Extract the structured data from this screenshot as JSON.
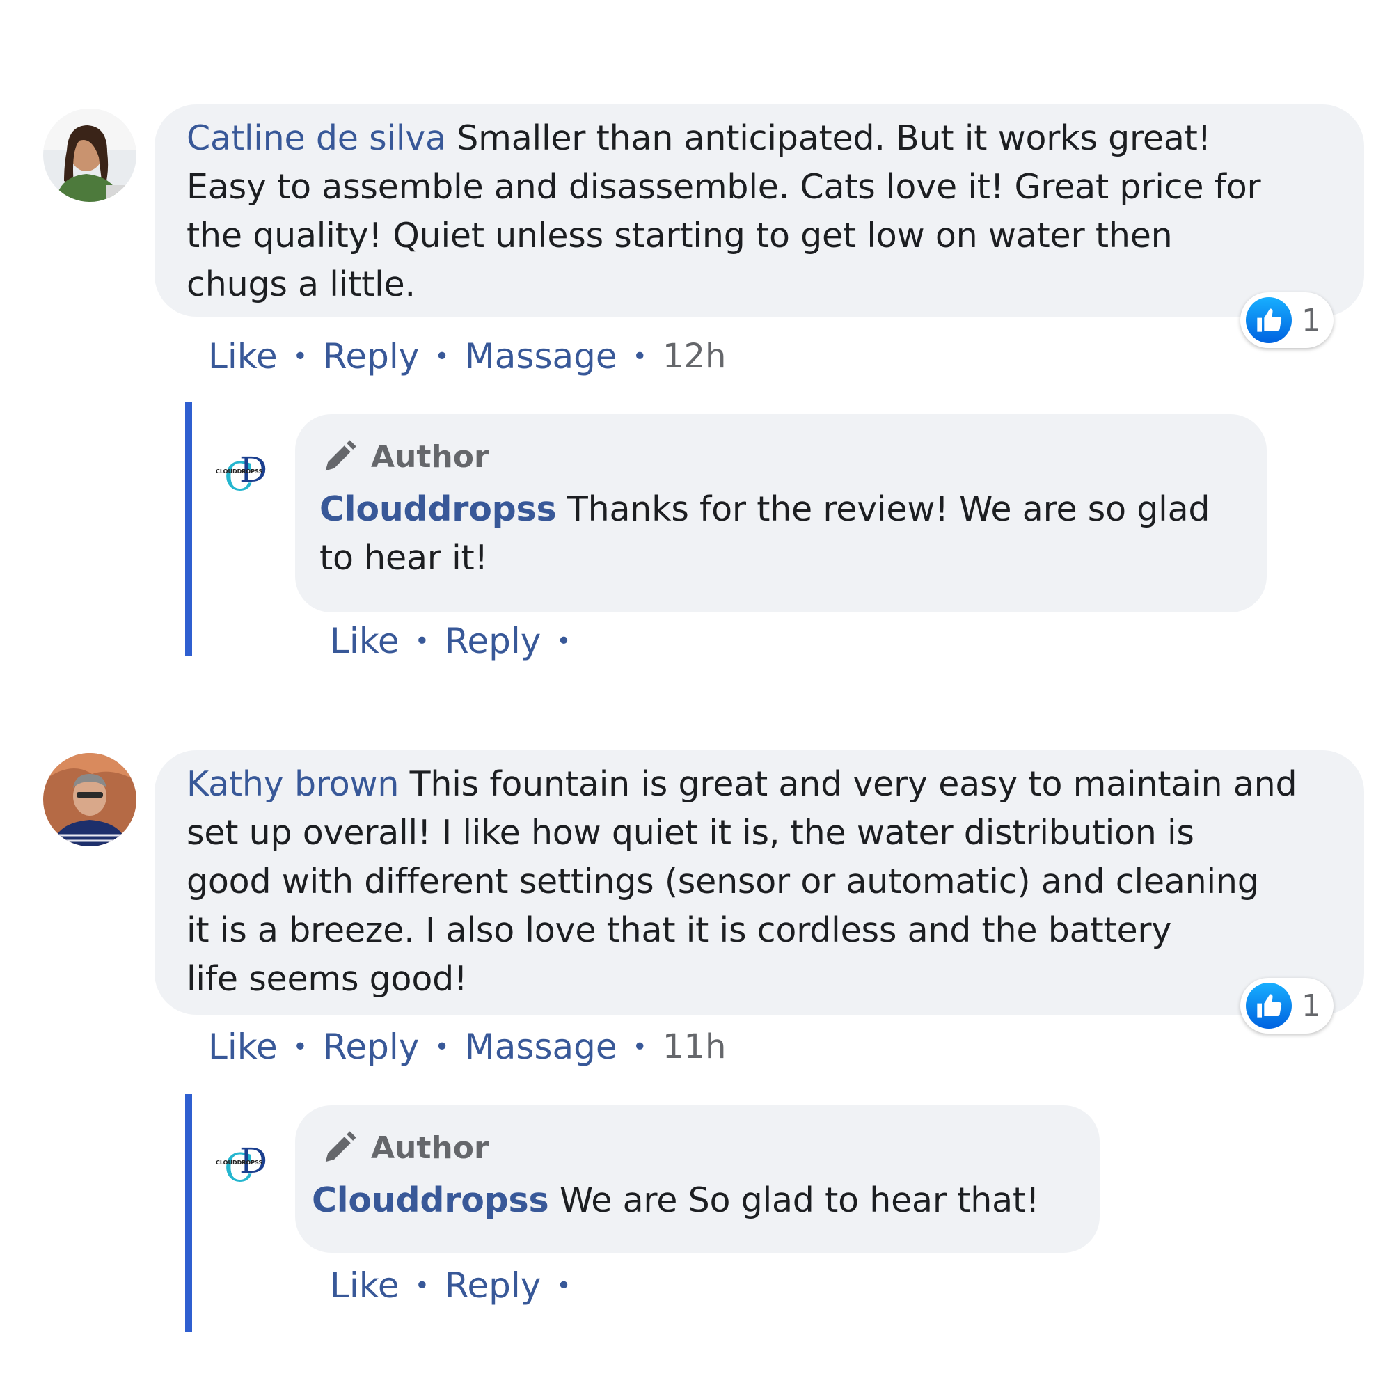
{
  "comments": [
    {
      "name": "Catline de silva",
      "text": "Smaller than anticipated. But it works great! Easy to assemble and disassemble. Cats love it! Great price for the quality! Quiet unless starting to get low on water then chugs a little.",
      "text_lines": [
        "Smaller than anticipated. But it works great!",
        "Easy to assemble and disassemble. Cats love it! Great price for",
        "the quality! Quiet unless starting to get low on water then",
        "chugs a little."
      ],
      "reaction_count": "1",
      "actions": {
        "like": "Like",
        "reply": "Reply",
        "message": "Massage",
        "time": "12h"
      },
      "reply": {
        "author_tag": "Author",
        "name": "Clouddropss",
        "text_lines": [
          "Thanks for the review! We are so glad",
          "to hear it!"
        ],
        "actions": {
          "like": "Like",
          "reply": "Reply"
        },
        "logo_text": "CLOUDDROPSS"
      }
    },
    {
      "name": "Kathy brown",
      "text_lines": [
        "This fountain is great and very easy to maintain and",
        "set up overall! I like how quiet it is, the water distribution is",
        "good with different settings (sensor or automatic) and cleaning",
        "it is a breeze. I also love that it is cordless and the battery",
        "life seems good!"
      ],
      "reaction_count": "1",
      "actions": {
        "like": "Like",
        "reply": "Reply",
        "message": "Massage",
        "time": "11h"
      },
      "reply": {
        "author_tag": "Author",
        "name": "Clouddropss",
        "text_lines": [
          "We are So glad to hear that!"
        ],
        "actions": {
          "like": "Like",
          "reply": "Reply"
        },
        "logo_text": "CLOUDDROPSS"
      }
    }
  ],
  "colors": {
    "link": "#385898",
    "bubble": "#f0f2f5",
    "thread": "#2f5fd0",
    "like_blue": "#0062e0"
  },
  "icons": [
    "like-thumb-icon",
    "pen-icon",
    "clouddropss-logo"
  ]
}
